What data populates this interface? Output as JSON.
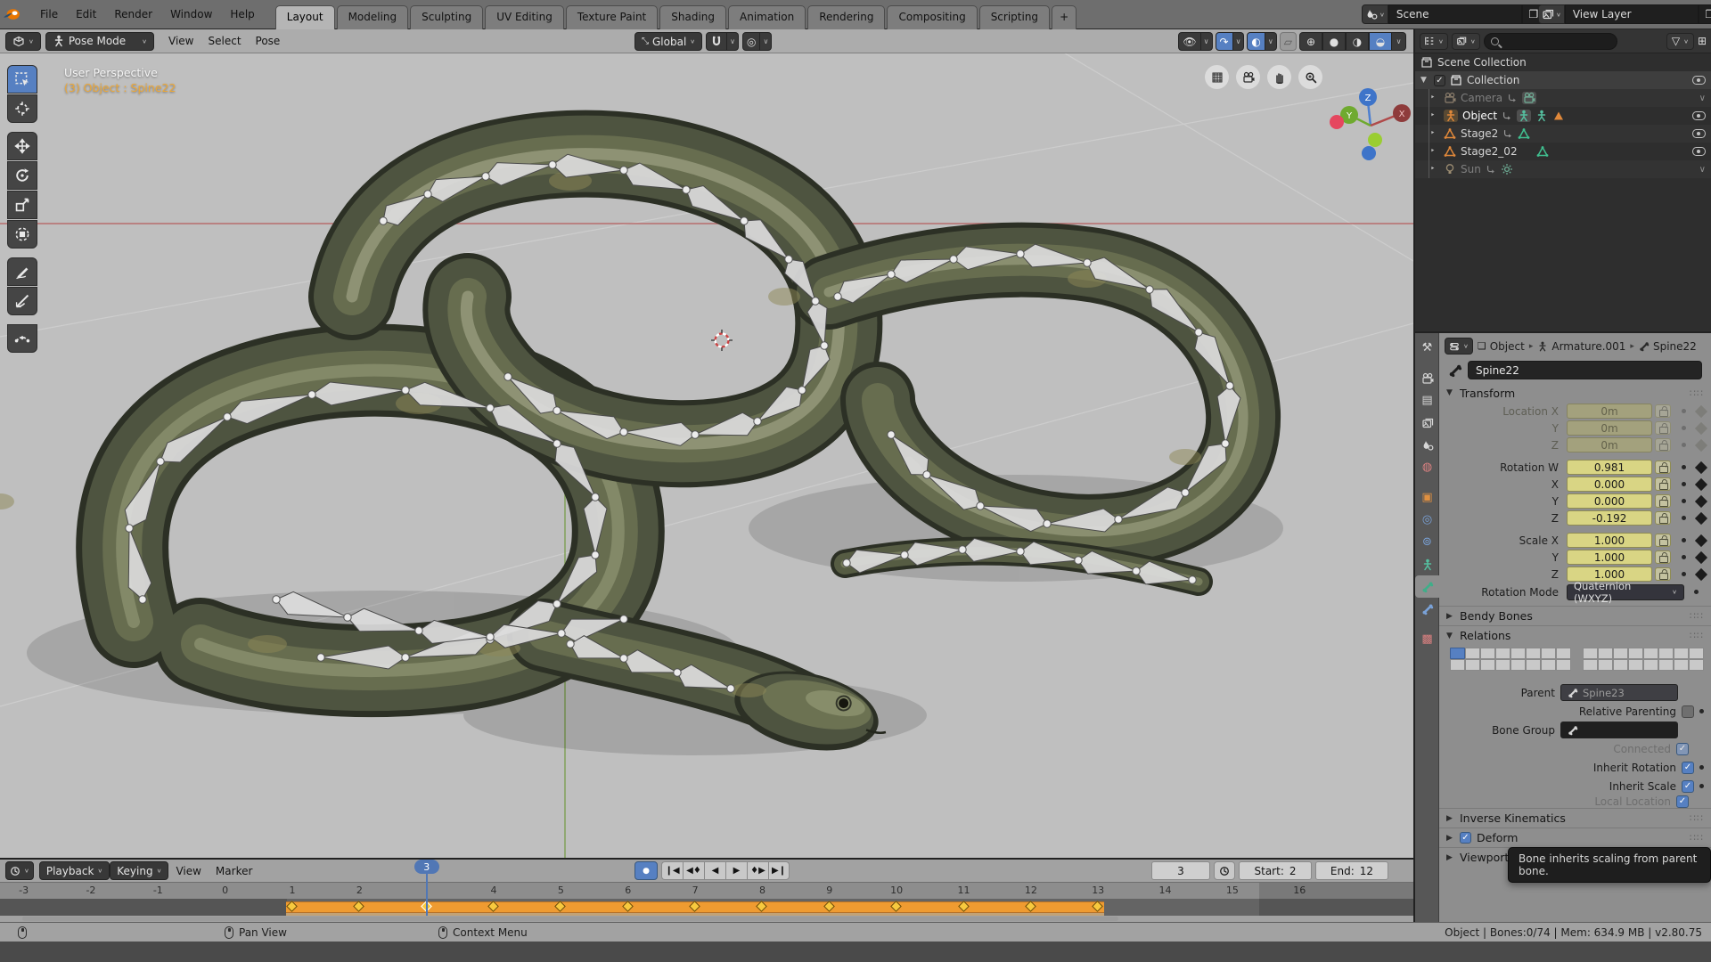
{
  "topbar": {
    "menus": [
      "File",
      "Edit",
      "Render",
      "Window",
      "Help"
    ],
    "tabs": [
      "Layout",
      "Modeling",
      "Sculpting",
      "UV Editing",
      "Texture Paint",
      "Shading",
      "Animation",
      "Rendering",
      "Compositing",
      "Scripting"
    ],
    "active_tab": "Layout",
    "new_tab_label": "+",
    "scene_label": "Scene",
    "view_layer_label": "View Layer"
  },
  "viewport": {
    "mode": "Pose Mode",
    "menus": [
      "View",
      "Select",
      "Pose"
    ],
    "orientation": "Global",
    "perspective_label": "User Perspective",
    "active_object_label": "(3) Object : Spine22",
    "gizmo_axes": {
      "x": "X",
      "y": "Y",
      "z": "Z"
    }
  },
  "outliner": {
    "root": "Scene Collection",
    "rows": [
      {
        "label": "Collection"
      },
      {
        "label": "Camera"
      },
      {
        "label": "Object"
      },
      {
        "label": "Stage2"
      },
      {
        "label": "Stage2_02"
      },
      {
        "label": "Sun"
      }
    ]
  },
  "properties": {
    "breadcrumb": {
      "object": "Object",
      "data": "Armature.001",
      "bone": "Spine22"
    },
    "bone_name": "Spine22",
    "panels": {
      "transform": "Transform",
      "bendy_bones": "Bendy Bones",
      "relations": "Relations",
      "inverse_kinematics": "Inverse Kinematics",
      "deform": "Deform",
      "viewport_display": "Viewport Display"
    },
    "transform": {
      "location": [
        {
          "label": "Location X",
          "value": "0m"
        },
        {
          "label": "Y",
          "value": "0m"
        },
        {
          "label": "Z",
          "value": "0m"
        }
      ],
      "rotation": [
        {
          "label": "Rotation W",
          "value": "0.981"
        },
        {
          "label": "X",
          "value": "0.000"
        },
        {
          "label": "Y",
          "value": "0.000"
        },
        {
          "label": "Z",
          "value": "-0.192"
        }
      ],
      "scale": [
        {
          "label": "Scale X",
          "value": "1.000"
        },
        {
          "label": "Y",
          "value": "1.000"
        },
        {
          "label": "Z",
          "value": "1.000"
        }
      ],
      "rotation_mode_label": "Rotation Mode",
      "rotation_mode": "Quaternion (WXYZ)"
    },
    "relations": {
      "parent_label": "Parent",
      "parent_value": "Spine23",
      "relative_parenting": "Relative Parenting",
      "bone_group_label": "Bone Group",
      "connected": "Connected",
      "inherit_rotation": "Inherit Rotation",
      "inherit_scale": "Inherit Scale",
      "local_location": "Local Location",
      "layers": {
        "groups": 2,
        "cols": 8,
        "rows": 2,
        "active_cell": 0
      }
    },
    "tooltip": "Bone inherits scaling from parent bone."
  },
  "timeline": {
    "menus": [
      "Playback",
      "Keying",
      "View",
      "Marker"
    ],
    "current_frame": "3",
    "current": 3,
    "start_label": "Start:",
    "start": "2",
    "end_label": "End:",
    "end": "12",
    "ruler_start": -3,
    "ruler_end": 16,
    "keyframes": [
      1,
      2,
      3,
      4,
      5,
      6,
      7,
      8,
      9,
      10,
      11,
      12,
      13
    ]
  },
  "statusbar": {
    "pan": "Pan View",
    "context": "Context Menu",
    "info": "Object | Bones:0/74  | Mem: 634.9 MB | v2.80.75"
  },
  "colors": {
    "accent_blue": "#5680c2",
    "keyframe_band": "#ef9b31",
    "active_object_text": "#eda838",
    "selected_tab": "#b5b5b5"
  }
}
